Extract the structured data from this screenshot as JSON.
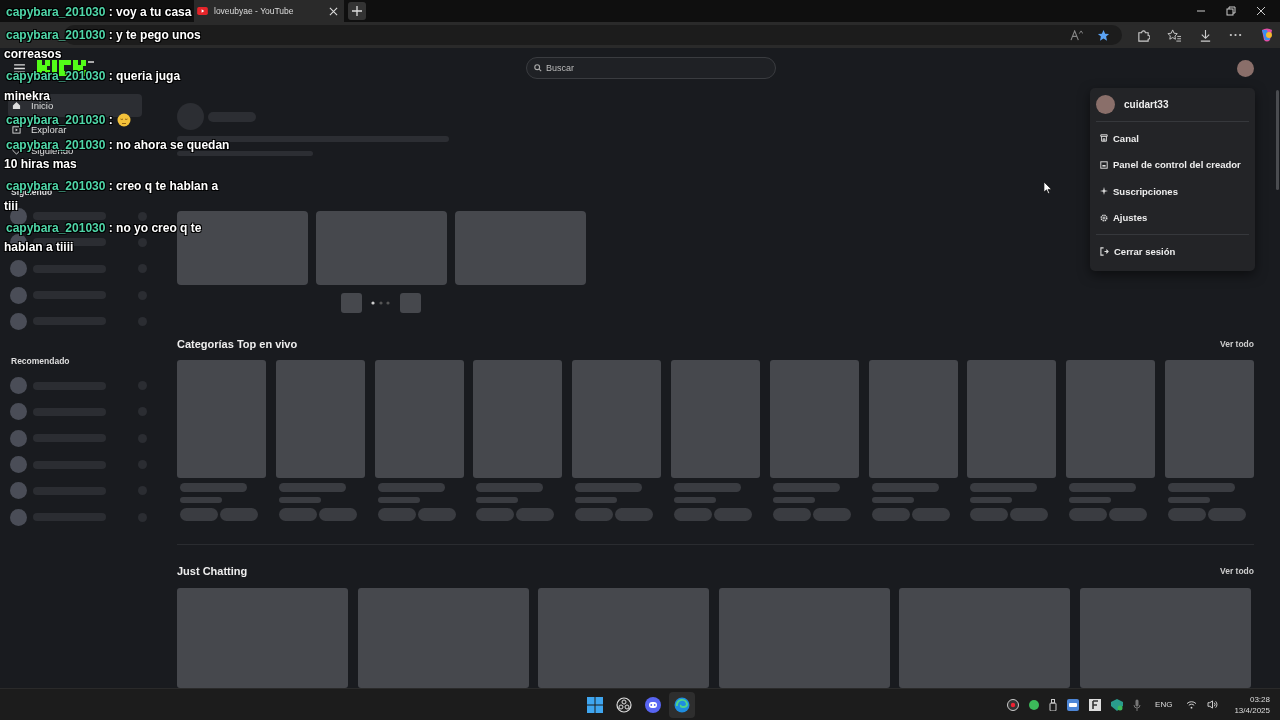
{
  "browser": {
    "tabs": [
      {
        "title": "loveubyae - YouTube",
        "selected": true
      }
    ]
  },
  "header": {
    "search": {
      "placeholder": "Buscar"
    }
  },
  "sidebar": {
    "nav": [
      {
        "label": "Inicio",
        "selected": true
      },
      {
        "label": "Explorar",
        "selected": false
      },
      {
        "label": "Siguiendo",
        "selected": false
      }
    ],
    "sections": [
      {
        "title": "Siguiendo"
      },
      {
        "title": "Recomendado"
      }
    ]
  },
  "main": {
    "sections": [
      {
        "title": "Categorías Top en vivo",
        "link": "Ver todo"
      },
      {
        "title": "Just Chatting",
        "link": "Ver todo"
      }
    ]
  },
  "user_menu": {
    "username": "cuidart33",
    "items": [
      "Canal",
      "Panel de control del creador",
      "Suscripciones",
      "Ajustes"
    ],
    "logout": "Cerrar sesión"
  },
  "chat_overlay": {
    "messages": [
      {
        "user": "capybara_201030",
        "kind": "text",
        "lines": [
          ": voy a tu casa"
        ]
      },
      {
        "user": "capybara_201030",
        "kind": "text",
        "lines": [
          ": y te pego unos",
          "correasos"
        ]
      },
      {
        "user": "capybara_201030",
        "kind": "text",
        "lines": [
          ": queria juga",
          "minekra"
        ]
      },
      {
        "user": "capybara_201030",
        "kind": "emoji",
        "lines": [
          ":"
        ]
      },
      {
        "user": "capybara_201030",
        "kind": "text",
        "lines": [
          ": no ahora se quedan",
          "10 hiras mas"
        ]
      },
      {
        "user": "capybara_201030",
        "kind": "text",
        "lines": [
          ": creo q te hablan a",
          "tiii"
        ]
      },
      {
        "user": "capybara_201030",
        "kind": "text",
        "lines": [
          ": no yo creo q te",
          "hablan a tiiii"
        ]
      }
    ]
  },
  "taskbar": {
    "language": "ENG",
    "time": "03:28",
    "date": "13/4/2025"
  }
}
